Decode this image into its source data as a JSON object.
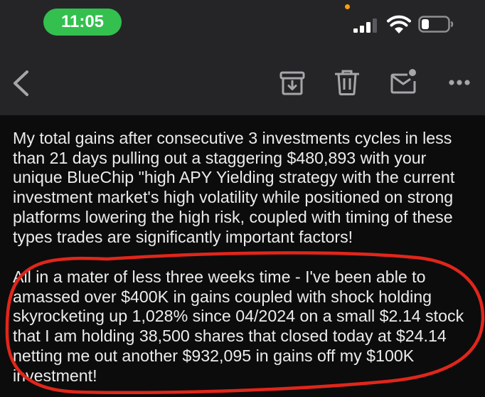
{
  "status_bar": {
    "time": "11:05"
  },
  "toolbar": {
    "icons": [
      "chevron-left-icon",
      "archive-icon",
      "trash-icon",
      "mail-unread-icon",
      "more-icon"
    ]
  },
  "message": {
    "paragraph_1": "My total gains after consecutive 3 investments cycles in less\nthan 21 days pulling out a staggering $480,893 with your\nunique BlueChip \"high APY Yielding strategy with the current\ninvestment market's high volatility while positioned on strong\nplatforms lowering the high risk, coupled with timing of these\ntypes trades are significantly important factors!",
    "paragraph_2": "All in a mater of less three weeks time -  I've been able to\namassed over $400K in gains coupled with shock holding\nskyrocketing up 1,028% since 04/2024 on a small $2.14 stock\nthat I am holding 38,500 shares that closed today at $24.14\nnetting me out another $932,095 in gains off my $100K\ninvestment!"
  },
  "colors": {
    "status_pill": "#33c04e",
    "toolbar_bg": "#252527",
    "icon": "#a6a6aa",
    "annotation": "#e0261b",
    "text": "#ececec"
  }
}
